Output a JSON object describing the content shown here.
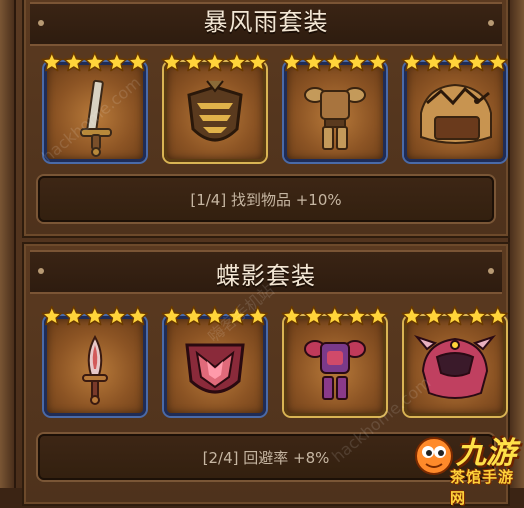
{
  "top_set": {
    "title": "暴风雨套装",
    "bonus": "[1/4] 找到物品 +10%",
    "cards": [
      {
        "icon": "sword-icon",
        "stars": 5,
        "rarity": "blue"
      },
      {
        "icon": "shield-icon",
        "stars": 5,
        "rarity": "gold"
      },
      {
        "icon": "armor-icon",
        "stars": 5,
        "rarity": "blue"
      },
      {
        "icon": "helmet-icon",
        "stars": 5,
        "rarity": "blue"
      }
    ]
  },
  "bottom_set": {
    "title": "蝶影套装",
    "bonus": "[2/4] 回避率 +8%",
    "cards": [
      {
        "icon": "dagger-icon",
        "stars": 5,
        "rarity": "blue"
      },
      {
        "icon": "emblem-shield-icon",
        "stars": 5,
        "rarity": "blue"
      },
      {
        "icon": "armor-icon",
        "stars": 5,
        "rarity": "gold"
      },
      {
        "icon": "helmet-icon",
        "stars": 5,
        "rarity": "gold"
      }
    ]
  },
  "watermark": {
    "text": "hackhome.com",
    "text2": "嗨客手机站"
  },
  "logo": {
    "big": "九游",
    "small": "茶馆手游网"
  },
  "colors": {
    "star": "#ffd43a",
    "frame_blue": "#4a6aa8",
    "frame_gold": "#d9b454"
  }
}
